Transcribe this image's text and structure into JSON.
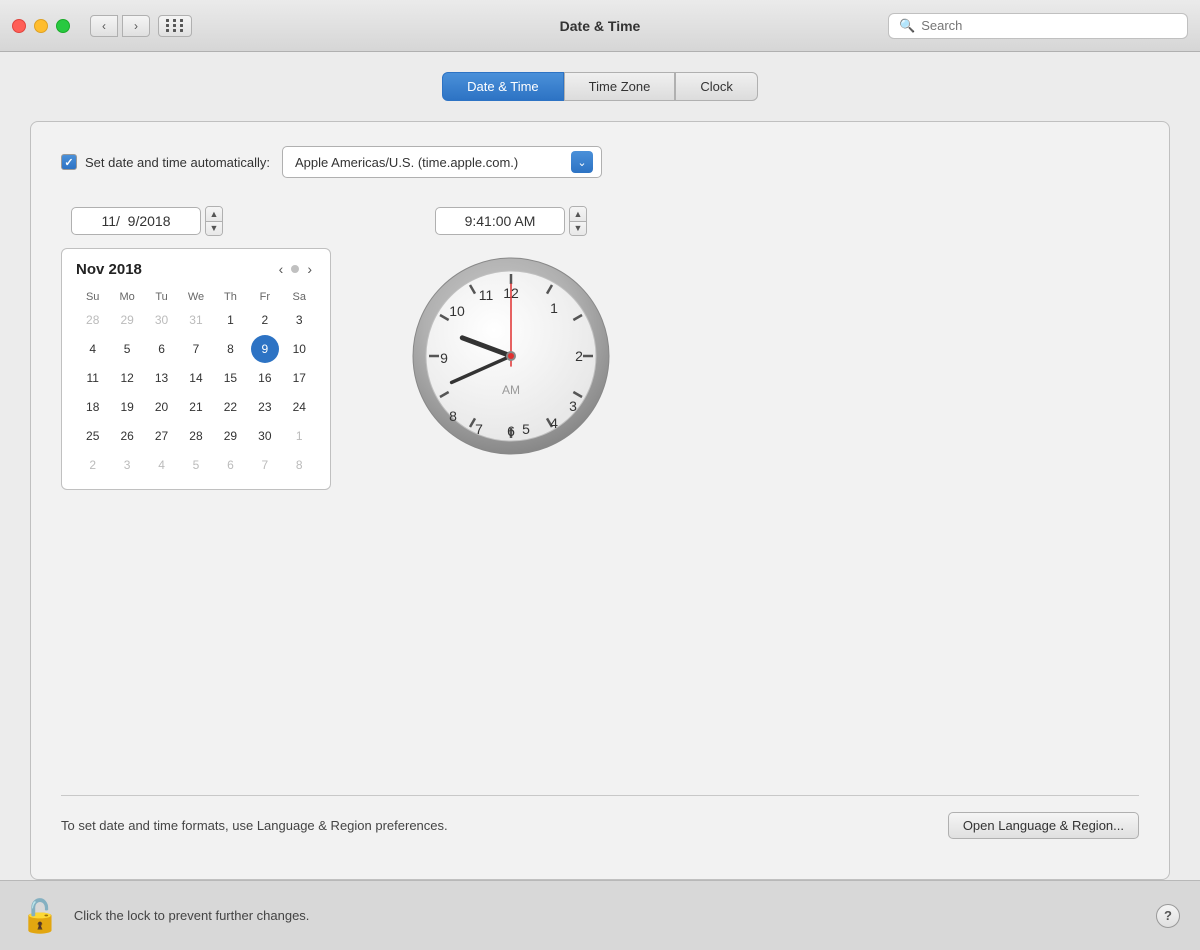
{
  "titlebar": {
    "title": "Date & Time",
    "search_placeholder": "Search"
  },
  "tabs": [
    {
      "id": "date-time",
      "label": "Date & Time",
      "active": true
    },
    {
      "id": "time-zone",
      "label": "Time Zone",
      "active": false
    },
    {
      "id": "clock",
      "label": "Clock",
      "active": false
    }
  ],
  "panel": {
    "auto_set_label": "Set date and time automatically:",
    "server_value": "Apple Americas/U.S. (time.apple.com.)",
    "date_value": "11/  9/2018",
    "time_value": "9:41:00 AM",
    "calendar": {
      "month_year": "Nov 2018",
      "day_headers": [
        "Su",
        "Mo",
        "Tu",
        "We",
        "Th",
        "Fr",
        "Sa"
      ],
      "days": [
        {
          "day": "28",
          "other": true
        },
        {
          "day": "29",
          "other": true
        },
        {
          "day": "30",
          "other": true
        },
        {
          "day": "31",
          "other": true
        },
        {
          "day": "1",
          "other": false
        },
        {
          "day": "2",
          "other": false
        },
        {
          "day": "3",
          "other": false
        },
        {
          "day": "4",
          "other": false
        },
        {
          "day": "5",
          "other": false
        },
        {
          "day": "6",
          "other": false
        },
        {
          "day": "7",
          "other": false
        },
        {
          "day": "8",
          "other": false
        },
        {
          "day": "9",
          "other": false,
          "selected": true
        },
        {
          "day": "10",
          "other": false
        },
        {
          "day": "11",
          "other": false
        },
        {
          "day": "12",
          "other": false
        },
        {
          "day": "13",
          "other": false
        },
        {
          "day": "14",
          "other": false
        },
        {
          "day": "15",
          "other": false
        },
        {
          "day": "16",
          "other": false
        },
        {
          "day": "17",
          "other": false
        },
        {
          "day": "18",
          "other": false
        },
        {
          "day": "19",
          "other": false
        },
        {
          "day": "20",
          "other": false
        },
        {
          "day": "21",
          "other": false
        },
        {
          "day": "22",
          "other": false
        },
        {
          "day": "23",
          "other": false
        },
        {
          "day": "24",
          "other": false
        },
        {
          "day": "25",
          "other": false
        },
        {
          "day": "26",
          "other": false
        },
        {
          "day": "27",
          "other": false
        },
        {
          "day": "28",
          "other": false
        },
        {
          "day": "29",
          "other": false
        },
        {
          "day": "30",
          "other": false
        },
        {
          "day": "1",
          "other": true
        },
        {
          "day": "2",
          "other": true
        },
        {
          "day": "3",
          "other": true
        },
        {
          "day": "4",
          "other": true
        },
        {
          "day": "5",
          "other": true
        },
        {
          "day": "6",
          "other": true
        },
        {
          "day": "7",
          "other": true
        },
        {
          "day": "8",
          "other": true
        }
      ]
    },
    "clock": {
      "hour": 9,
      "minute": 41,
      "second": 0,
      "period": "AM",
      "hour_angle": 285,
      "minute_angle": 246,
      "second_angle": 0
    },
    "bottom_info": "To set date and time formats, use Language & Region preferences.",
    "open_prefs_label": "Open Language & Region..."
  },
  "lock_bar": {
    "lock_text": "Click the lock to prevent further changes."
  }
}
